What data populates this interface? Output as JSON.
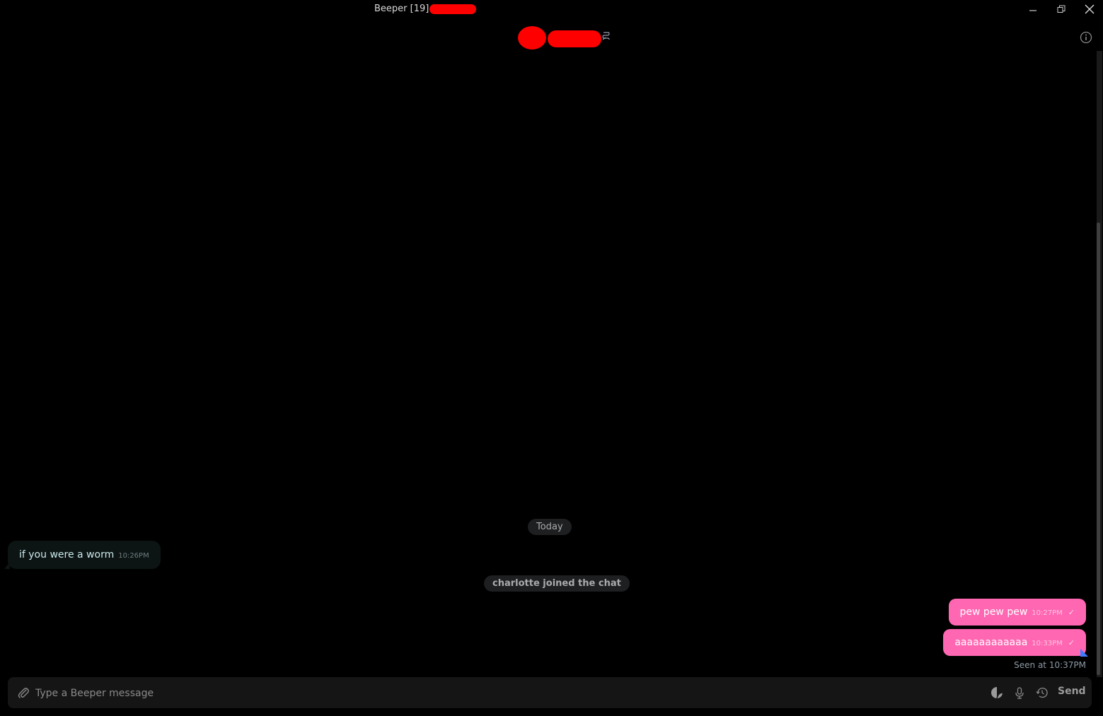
{
  "window": {
    "title": "Beeper [19] |",
    "controls": {
      "minimize": "minimize-icon",
      "restore": "restore-icon",
      "close": "close-icon"
    }
  },
  "chat_header": {
    "avatar": "redacted",
    "name": "redacted",
    "network_icon": "chat-network-icon",
    "info_icon": "info-icon"
  },
  "messages": {
    "date_separator": "Today",
    "incoming": [
      {
        "text": "if you were a worm",
        "time": "10:26PM"
      }
    ],
    "system_event": "charlotte joined the chat",
    "outgoing": [
      {
        "text": "pew pew pew",
        "time": "10:27PM",
        "status": "✓"
      },
      {
        "text": "aaaaaaaaaaaa",
        "time": "10:33PM",
        "status": "✓"
      }
    ],
    "read_receipt": "Seen at 10:37PM"
  },
  "composer": {
    "placeholder": "Type a Beeper message",
    "value": "",
    "send_label": "Send",
    "icons": [
      "attach-icon",
      "sticker-icon",
      "microphone-icon",
      "history-icon"
    ]
  },
  "colors": {
    "outgoing_bubble": "#ff67b2",
    "incoming_bubble": "#0c1414",
    "pill": "#1d1f21",
    "composer": "#151515",
    "background": "#000000"
  }
}
